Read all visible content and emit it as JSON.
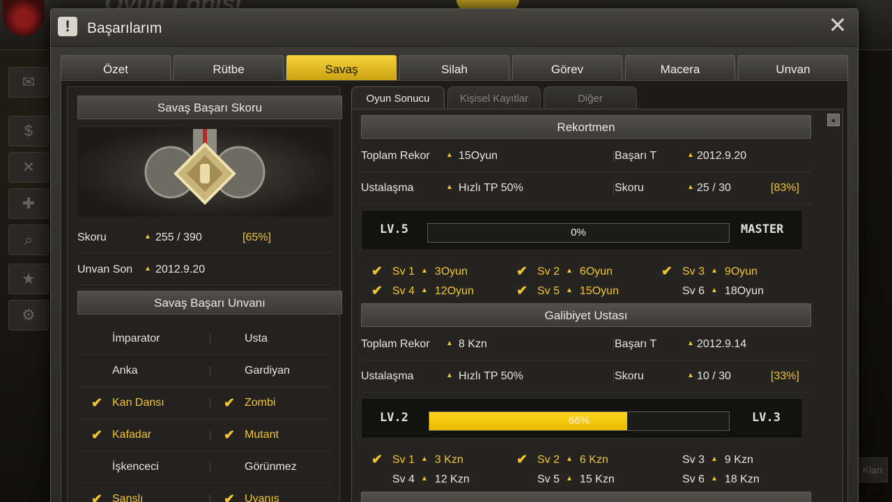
{
  "dialog": {
    "title": "Başarılarım"
  },
  "tabs": [
    "Özet",
    "Rütbe",
    "Savaş",
    "Silah",
    "Görev",
    "Macera",
    "Unvan"
  ],
  "sub_tabs": [
    "Oyun Sonucu",
    "Kişisel Kayıtlar",
    "Diğer"
  ],
  "left": {
    "score_header": "Savaş Başarı Skoru",
    "score_label": "Skoru",
    "score_value": "255 / 390",
    "score_pct": "[65%]",
    "title_last_label": "Unvan Son",
    "title_last_date": "2012.9.20",
    "titles_header": "Savaş Başarı Unvanı",
    "titles": [
      {
        "left": "İmparator",
        "left_done": false,
        "right": "Usta",
        "right_done": false
      },
      {
        "left": "Anka",
        "left_done": false,
        "right": "Gardiyan",
        "right_done": false
      },
      {
        "left": "Kan Dansı",
        "left_done": true,
        "right": "Zombi",
        "right_done": true
      },
      {
        "left": "Kafadar",
        "left_done": true,
        "right": "Mutant",
        "right_done": true
      },
      {
        "left": "İşkenceci",
        "left_done": false,
        "right": "Görünmez",
        "right_done": false
      },
      {
        "left": "Şanslı",
        "left_done": true,
        "right": "Uyanış",
        "right_done": true
      }
    ]
  },
  "sections": [
    {
      "header": "Rekortmen",
      "total_label": "Toplam Rekor",
      "total_value": "15Oyun",
      "basari_label": "Başarı T",
      "basari_date": "2012.9.20",
      "ustalasma_label": "Ustalaşma",
      "ustalasma_value": "Hızlı TP 50%",
      "skor_label": "Skoru",
      "skor_value": "25 / 30",
      "skor_pct": "[83%]",
      "lv_left": "LV.5",
      "lv_right": "MASTER",
      "progress": 0,
      "progress_text": "0%",
      "achievements": [
        {
          "level": "Sv 1",
          "value": "3Oyun",
          "done": true
        },
        {
          "level": "Sv 2",
          "value": "6Oyun",
          "done": true
        },
        {
          "level": "Sv 3",
          "value": "9Oyun",
          "done": true
        },
        {
          "level": "Sv 4",
          "value": "12Oyun",
          "done": true
        },
        {
          "level": "Sv 5",
          "value": "15Oyun",
          "done": true
        },
        {
          "level": "Sv 6",
          "value": "18Oyun",
          "done": false
        }
      ]
    },
    {
      "header": "Galibiyet Ustası",
      "total_label": "Toplam Rekor",
      "total_value": "8 Kzn",
      "basari_label": "Başarı T",
      "basari_date": "2012.9.14",
      "ustalasma_label": "Ustalaşma",
      "ustalasma_value": "Hızlı TP 50%",
      "skor_label": "Skoru",
      "skor_value": "10 / 30",
      "skor_pct": "[33%]",
      "lv_left": "LV.2",
      "lv_right": "LV.3",
      "progress": 66,
      "progress_text": "66%",
      "achievements": [
        {
          "level": "Sv 1",
          "value": "3 Kzn",
          "done": true
        },
        {
          "level": "Sv 2",
          "value": "6 Kzn",
          "done": true
        },
        {
          "level": "Sv 3",
          "value": "9 Kzn",
          "done": false
        },
        {
          "level": "Sv 4",
          "value": "12 Kzn",
          "done": false
        },
        {
          "level": "Sv 5",
          "value": "15 Kzn",
          "done": false
        },
        {
          "level": "Sv 6",
          "value": "18 Kzn",
          "done": false
        }
      ]
    }
  ],
  "background": {
    "lobby_title": "Oyun Lobisi",
    "right_label": "Klan"
  },
  "colors": {
    "accent": "#f3c52e",
    "tab_active": "#e6bd1e",
    "panel": "#232220"
  }
}
